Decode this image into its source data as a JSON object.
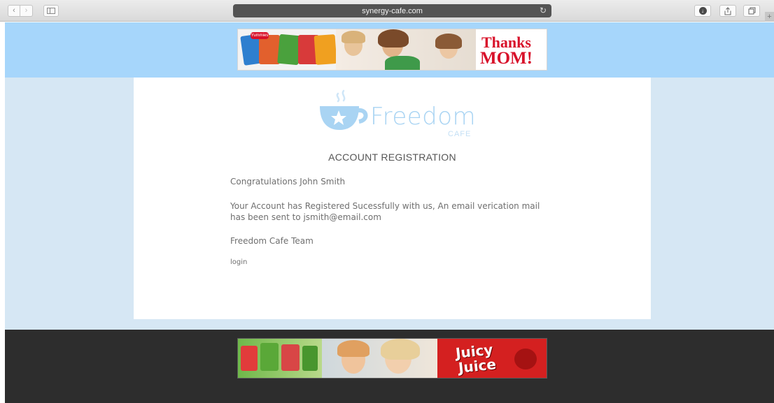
{
  "browser": {
    "url": "synergy-cafe.com",
    "icons": {
      "back": "chevron-left-icon",
      "forward": "chevron-right-icon",
      "sidebar": "sidebar-icon",
      "reload": "reload-icon",
      "downloads": "download-icon",
      "share": "share-icon",
      "tabs": "tabs-icon",
      "new_tab": "plus-icon"
    }
  },
  "ads": {
    "top": {
      "brand_small": "Yummies",
      "headline_line1": "Thanks",
      "headline_line2": "MOM!"
    },
    "bottom": {
      "brand_line1": "Juicy",
      "brand_line2": "Juice"
    }
  },
  "brand": {
    "name": "Freedom",
    "sub": "CAFE"
  },
  "registration": {
    "title": "ACCOUNT REGISTRATION",
    "greeting": "Congratulations John Smith",
    "message": "Your Account has Registered Sucessfully with us, An email verication mail has been sent to jsmith@email.com",
    "signoff": "Freedom Cafe Team",
    "login_label": "login"
  },
  "colors": {
    "top_band": "#a6d6fb",
    "page_bg": "#d6e7f4",
    "logo_blue": "#a9d4f3",
    "footer": "#2d2d2d",
    "ad_red": "#d8112a"
  }
}
